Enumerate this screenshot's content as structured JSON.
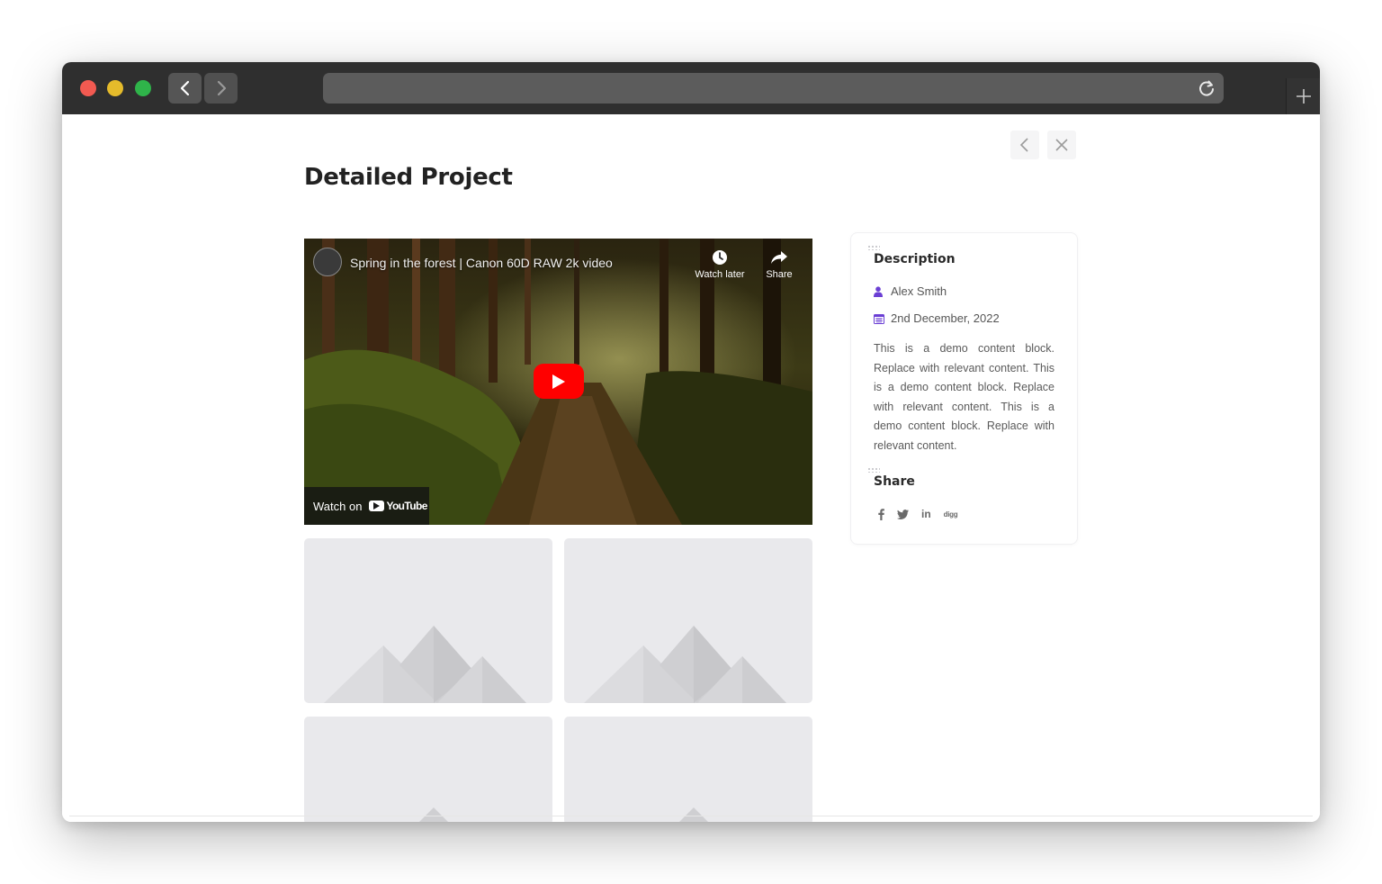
{
  "browser": {
    "url": "",
    "colors": {
      "close": "#f25a51",
      "minimize": "#e5bb2b",
      "maximize": "#2fb44a",
      "chrome": "#2f2f2f"
    }
  },
  "page": {
    "title": "Detailed Project"
  },
  "video": {
    "title": "Spring in the forest | Canon 60D RAW 2k video",
    "watch_later_label": "Watch later",
    "share_label": "Share",
    "watch_on_label": "Watch on",
    "youtube_label": "YouTube",
    "play_color": "#ff0000"
  },
  "gallery": {
    "items": [
      "image-placeholder",
      "image-placeholder",
      "image-placeholder",
      "image-placeholder"
    ]
  },
  "sidebar": {
    "description_heading": "Description",
    "author": "Alex Smith",
    "date": "2nd December, 2022",
    "description": "This is a demo content block. Replace with relevant content. This is a demo content block. Replace with relevant content. This is a demo content block. Replace with relevant content.",
    "share_heading": "Share",
    "social": [
      "facebook-icon",
      "twitter-icon",
      "linkedin-icon",
      "digg-icon"
    ],
    "social_labels": {
      "linkedin": "in",
      "digg": "digg"
    },
    "accent_color": "#6b3fd4"
  }
}
